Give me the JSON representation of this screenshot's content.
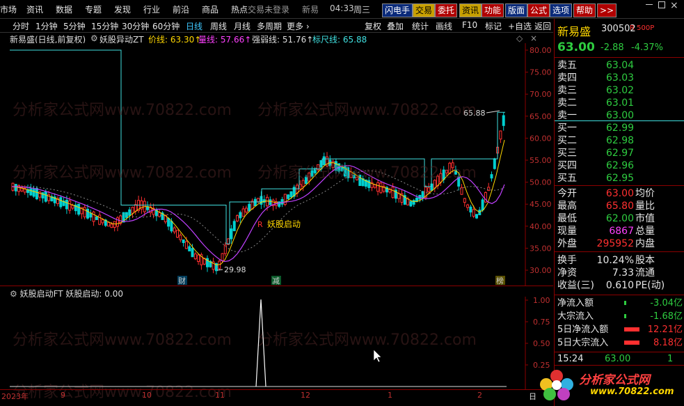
{
  "menu": [
    "市场",
    "资讯",
    "数据",
    "专题",
    "发现",
    "行业",
    "前沿",
    "商品",
    "热点"
  ],
  "login_text": "交易未登录",
  "clock": "04:33",
  "weekday": "周三",
  "clock_prefix": "新易",
  "top_buttons": [
    "闪电手",
    "交易",
    "委托",
    "资讯",
    "功能",
    "版面",
    "公式",
    "选项",
    "帮助",
    ">>"
  ],
  "periods": [
    "分时",
    "1分钟",
    "5分钟",
    "15分钟",
    "30分钟",
    "60分钟",
    "日线",
    "周线",
    "月线",
    "多周期",
    "更多 ›"
  ],
  "active_period": "日线",
  "tools": [
    "复权",
    "叠加",
    "统计",
    "画线",
    "F10",
    "标记",
    "+自选",
    "返回"
  ],
  "chart_info": {
    "stock_label": "新易盛(日线,前复权)",
    "indicator_name": "妖股异动ZT",
    "price_label": "价线: 63.30↑",
    "volume_label": "量线: 57.66↑",
    "strength_label": "强弱线: 51.76↑",
    "ruler_label": "标尺线: 65.88"
  },
  "price_axis": [
    "80.00",
    "75.00",
    "70.00",
    "65.00",
    "60.00",
    "55.00",
    "50.00",
    "45.00",
    "40.00",
    "35.00",
    "30.00"
  ],
  "annotations": {
    "high": "65.88",
    "low": "29.98",
    "signal": "妖股启动"
  },
  "event_marks": [
    "财",
    "减",
    "榜"
  ],
  "sub_chart": {
    "title": "妖股启动FT 妖股启动: 0.00",
    "axis": [
      "1.00",
      "0.75",
      "0.50",
      "0.25"
    ]
  },
  "x_axis": [
    "2023年",
    "9",
    "10",
    "11",
    "12",
    "1",
    "2"
  ],
  "x_axis_end": "日",
  "watermark_text": "分析家公式网www.70822.com",
  "stock": {
    "name": "新易盛",
    "code": "300502",
    "tag": "R 500P"
  },
  "price": {
    "last": "63.00",
    "change": "-2.88",
    "pct": "-4.37%"
  },
  "asks": [
    {
      "label": "卖五",
      "price": "63.04"
    },
    {
      "label": "卖四",
      "price": "63.03"
    },
    {
      "label": "卖三",
      "price": "63.02"
    },
    {
      "label": "卖二",
      "price": "63.01"
    },
    {
      "label": "卖一",
      "price": "63.00"
    }
  ],
  "bids": [
    {
      "label": "买一",
      "price": "62.99"
    },
    {
      "label": "买二",
      "price": "62.98"
    },
    {
      "label": "买三",
      "price": "62.97"
    },
    {
      "label": "买四",
      "price": "62.96"
    },
    {
      "label": "买五",
      "price": "62.95"
    }
  ],
  "stats": [
    {
      "l1": "今开",
      "v1": "63.00",
      "c1": "red",
      "l2": "均价"
    },
    {
      "l1": "最高",
      "v1": "65.80",
      "c1": "red",
      "l2": "量比"
    },
    {
      "l1": "最低",
      "v1": "62.00",
      "c1": "green",
      "l2": "市值"
    },
    {
      "l1": "现量",
      "v1": "6867",
      "c1": "magenta",
      "l2": "总量"
    },
    {
      "l1": "外盘",
      "v1": "295952",
      "c1": "red",
      "l2": "内盘"
    }
  ],
  "stats2": [
    {
      "l1": "换手",
      "v1": "10.24%",
      "l2": "股本"
    },
    {
      "l1": "净资",
      "v1": "7.33",
      "l2": "流通"
    },
    {
      "l1": "收益(三)",
      "v1": "0.610",
      "l2": "PE(动)"
    }
  ],
  "flows": [
    {
      "label": "净流入额",
      "value": "-3.04亿",
      "color": "green"
    },
    {
      "label": "大宗流入",
      "value": "-1.68亿",
      "color": "green"
    },
    {
      "label": "5日净流入额",
      "value": "12.21亿",
      "color": "red"
    },
    {
      "label": "5日大宗流入",
      "value": "8.18亿",
      "color": "red"
    }
  ],
  "tick": {
    "time": "15:24",
    "price": "63.00",
    "vol": "1"
  },
  "logo_text": "分析家公式网",
  "logo_url": "www.70822.com",
  "colors": {
    "up": "#ff3030",
    "down": "#00d0d0",
    "ruler": "#40e0e0",
    "grid": "#8b0000"
  }
}
